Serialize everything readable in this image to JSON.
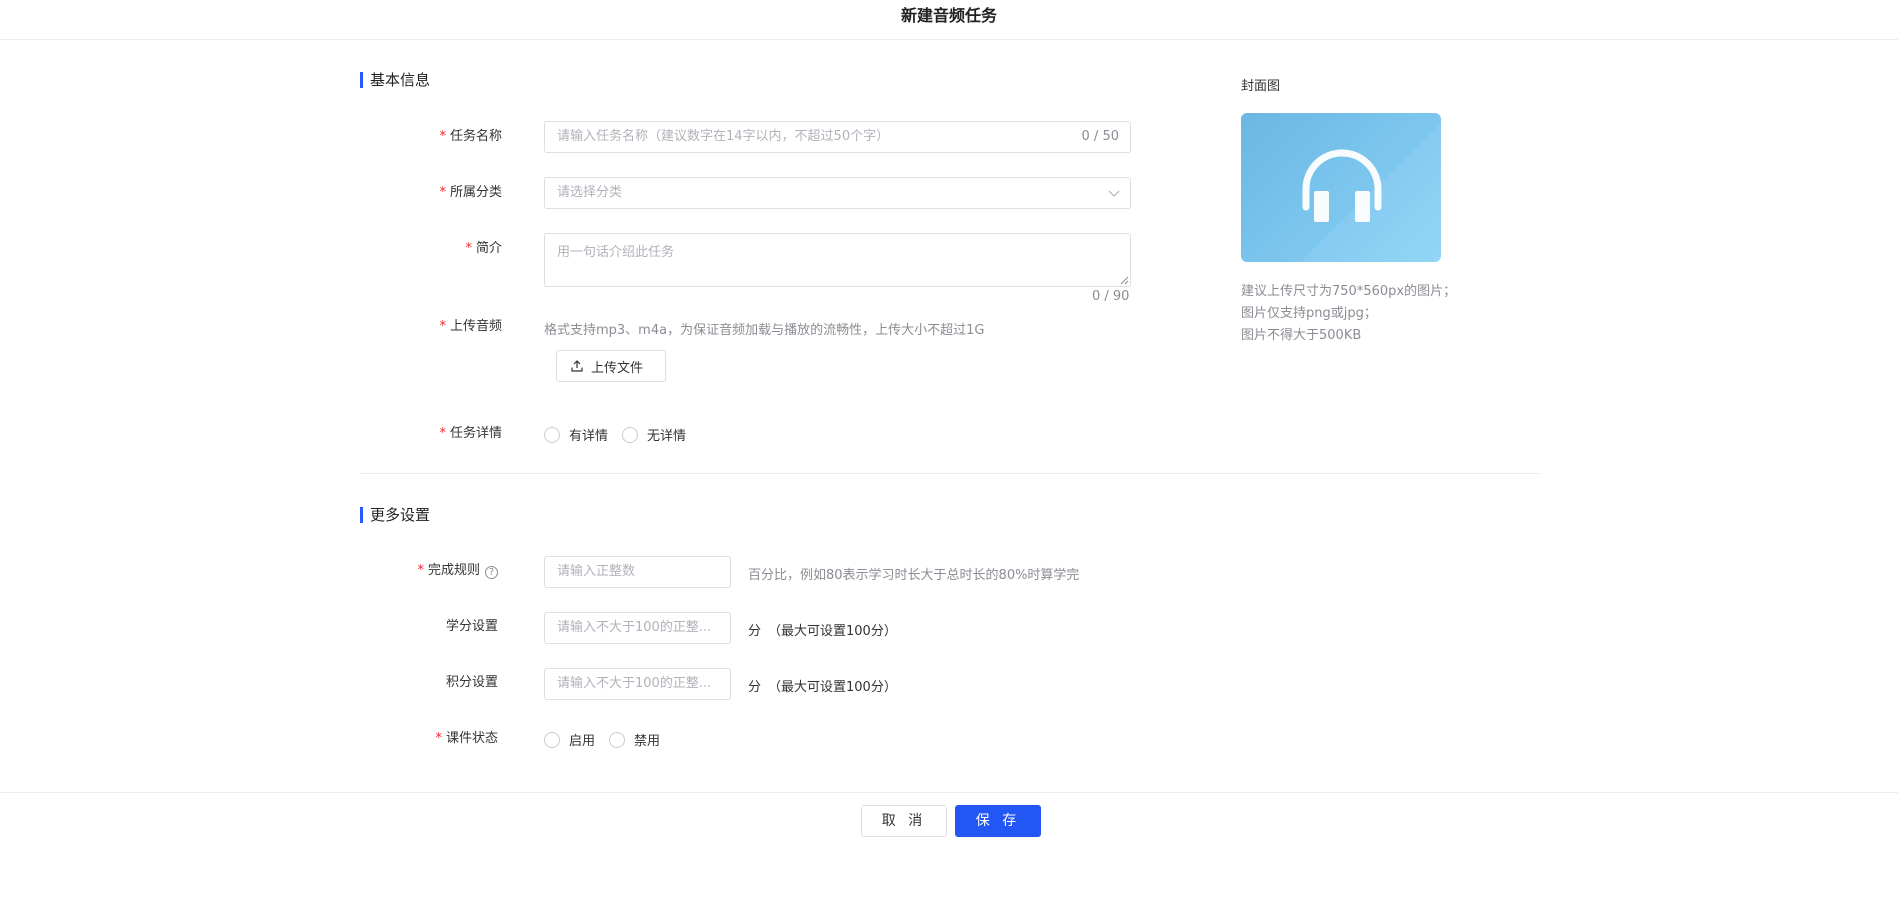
{
  "header": {
    "title": "新建音频任务"
  },
  "basic": {
    "section_title": "基本信息",
    "task_name": {
      "label": "任务名称",
      "placeholder": "请输入任务名称（建议数字在14字以内，不超过50个字）",
      "count": "0 / 50"
    },
    "category": {
      "label": "所属分类",
      "placeholder": "请选择分类"
    },
    "intro": {
      "label": "简介",
      "placeholder": "用一句话介绍此任务",
      "count": "0 / 90"
    },
    "audio": {
      "label": "上传音频",
      "hint": "格式支持mp3、m4a，为保证音频加载与播放的流畅性，上传大小不超过1G",
      "button": "上传文件"
    },
    "detail": {
      "label": "任务详情",
      "options": [
        "有详情",
        "无详情"
      ]
    }
  },
  "cover": {
    "label": "封面图",
    "notes": [
      "建议上传尺寸为750*560px的图片；",
      "图片仅支持png或jpg；",
      "图片不得大于500KB"
    ],
    "icon": "headphones-icon"
  },
  "more": {
    "section_title": "更多设置",
    "completion": {
      "label": "完成规则",
      "placeholder": "请输入正整数",
      "hint": "百分比，例如80表示学习时长大于总时长的80%时算学完"
    },
    "credit": {
      "label": "学分设置",
      "placeholder": "请输入不大于100的正整...",
      "unit": "分",
      "hint": "（最大可设置100分）"
    },
    "points": {
      "label": "积分设置",
      "placeholder": "请输入不大于100的正整...",
      "unit": "分",
      "hint": "（最大可设置100分）"
    },
    "status": {
      "label": "课件状态",
      "options": [
        "启用",
        "禁用"
      ]
    }
  },
  "footer": {
    "cancel": "取 消",
    "save": "保 存"
  },
  "colors": {
    "accent": "#2256f5",
    "required": "#f5222d",
    "section_bar": "#2a5bff"
  }
}
